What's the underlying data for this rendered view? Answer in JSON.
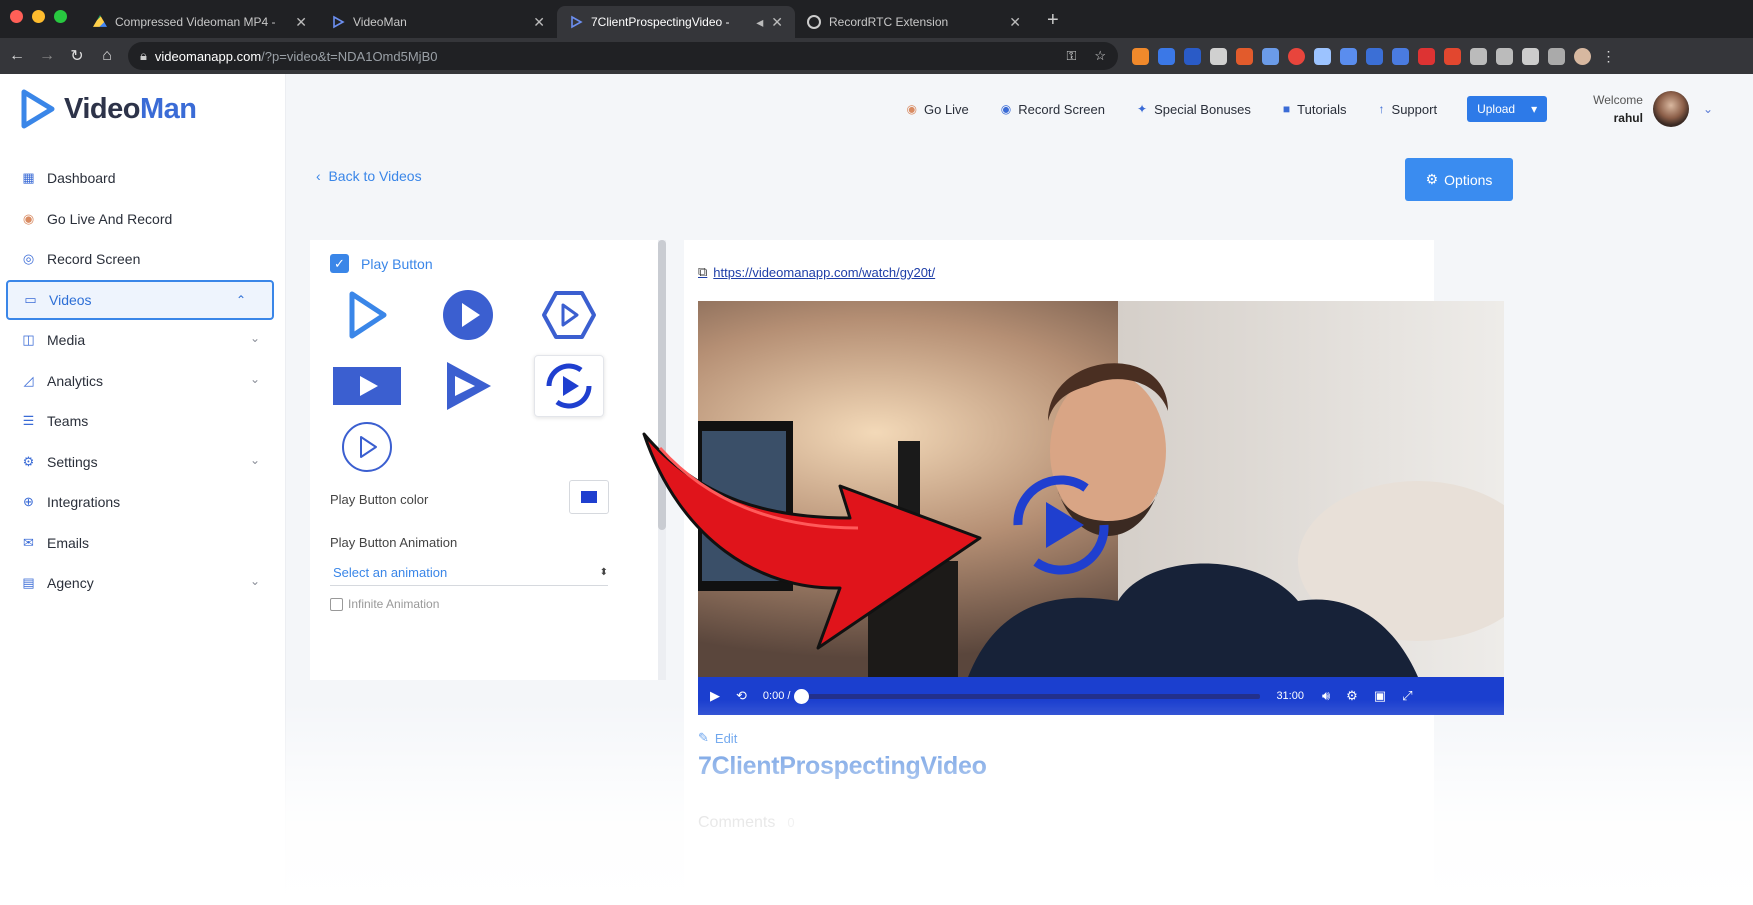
{
  "browser": {
    "tabs": [
      {
        "title": "Compressed Videoman MP4 -",
        "active": false
      },
      {
        "title": "VideoMan",
        "active": false
      },
      {
        "title": "7ClientProspectingVideo -",
        "active": true
      },
      {
        "title": "RecordRTC Extension",
        "active": false
      }
    ],
    "url_host": "videomanapp.com",
    "url_path": "/?p=video&t=NDA1Omd5MjB0"
  },
  "logo": {
    "part1": "Video",
    "part2": "Man"
  },
  "sidebar": {
    "items": [
      {
        "label": "Dashboard",
        "icon": "dashboard-icon"
      },
      {
        "label": "Go Live And Record",
        "icon": "live-icon"
      },
      {
        "label": "Record Screen",
        "icon": "record-icon"
      },
      {
        "label": "Videos",
        "icon": "video-icon",
        "active": true
      },
      {
        "label": "Media",
        "icon": "media-icon"
      },
      {
        "label": "Analytics",
        "icon": "analytics-icon"
      },
      {
        "label": "Teams",
        "icon": "teams-icon"
      },
      {
        "label": "Settings",
        "icon": "settings-icon"
      },
      {
        "label": "Integrations",
        "icon": "integrations-icon"
      },
      {
        "label": "Emails",
        "icon": "emails-icon"
      },
      {
        "label": "Agency",
        "icon": "agency-icon"
      }
    ]
  },
  "topnav": {
    "go_live": "Go Live",
    "record_screen": "Record Screen",
    "special_bonuses": "Special Bonuses",
    "tutorials": "Tutorials",
    "support": "Support",
    "upload": "Upload",
    "welcome": "Welcome",
    "user": "rahul"
  },
  "back_link": "Back to Videos",
  "options_label": "Options",
  "panel": {
    "play_button_label": "Play Button",
    "play_button_color_label": "Play Button color",
    "play_button_color": "#1f3fcf",
    "animation_label": "Play Button Animation",
    "animation_value": "Select an animation",
    "infinite_label": "Infinite Animation"
  },
  "video": {
    "share_url": "https://videomanapp.com/watch/gy20t/",
    "time_current": "0:00 /",
    "time_total": "31:00",
    "edit_label": "Edit",
    "title": "7ClientProspectingVideo",
    "comments_label": "Comments",
    "comments_count": "0"
  },
  "colors": {
    "brand": "#3a6bd6",
    "accent": "#3a86e8",
    "player_bar": "#1b3fcf",
    "arrow": "#e0141b"
  }
}
